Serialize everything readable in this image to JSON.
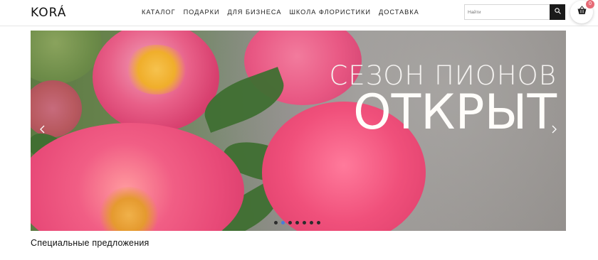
{
  "header": {
    "logo": "KORÁ",
    "nav": [
      {
        "label": "КАТАЛОГ"
      },
      {
        "label": "ПОДАРКИ"
      },
      {
        "label": "ДЛЯ БИЗНЕСА"
      },
      {
        "label": "ШКОЛА ФЛОРИСТИКИ"
      },
      {
        "label": "ДОСТАВКА"
      }
    ],
    "search": {
      "placeholder": "Найти"
    },
    "cart": {
      "count": "0"
    }
  },
  "banner": {
    "line1": "СЕЗОН ПИОНОВ",
    "line2": "ОТКРЫТ",
    "dots_total": 7,
    "active_dot": 2
  },
  "sections": {
    "special_offers": "Специальные предложения"
  },
  "colors": {
    "accent": "#e66a76",
    "active_dot": "#4b7bd8",
    "search_button": "#1a1a1a"
  }
}
